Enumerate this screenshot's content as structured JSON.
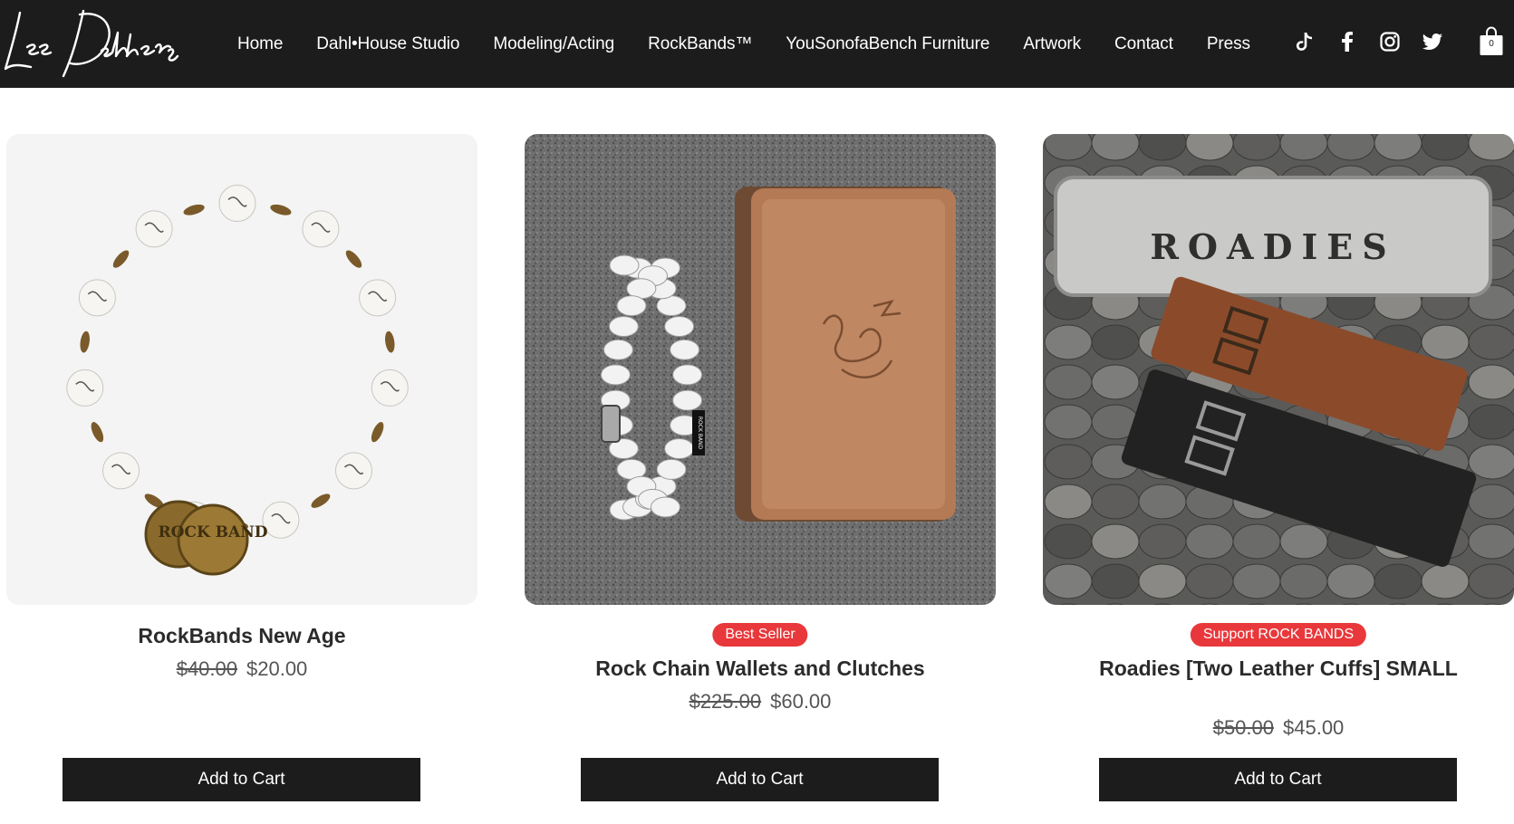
{
  "brand": {
    "logo_text": "Lee Dahlberg"
  },
  "nav": {
    "items": [
      {
        "label": "Home"
      },
      {
        "label": "Dahl•House Studio"
      },
      {
        "label": "Modeling/Acting"
      },
      {
        "label": "RockBands™"
      },
      {
        "label": "YouSonofaBench Furniture"
      },
      {
        "label": "Artwork"
      },
      {
        "label": "Contact"
      },
      {
        "label": "Press"
      }
    ]
  },
  "social": [
    "tiktok-icon",
    "facebook-icon",
    "instagram-icon",
    "twitter-icon"
  ],
  "cart": {
    "count": "0"
  },
  "products": [
    {
      "title": "RockBands New Age",
      "badge": "",
      "old_price": "$40.00",
      "price": "$20.00",
      "button": "Add to Cart",
      "image_text": "ROCK BAND"
    },
    {
      "title": "Rock Chain Wallets and Clutches",
      "badge": "Best Seller",
      "old_price": "$225.00",
      "price": "$60.00",
      "button": "Add to Cart",
      "image_text": "ROCK BAND"
    },
    {
      "title": "Roadies [Two Leather Cuffs] SMALL",
      "badge": "Support ROCK BANDS",
      "old_price": "$50.00",
      "price": "$45.00",
      "button": "Add to Cart",
      "image_text": "ROADIES"
    }
  ],
  "colors": {
    "header_bg": "#1c1c1c",
    "badge_bg": "#e8383b",
    "button_bg": "#1c1c1c"
  }
}
